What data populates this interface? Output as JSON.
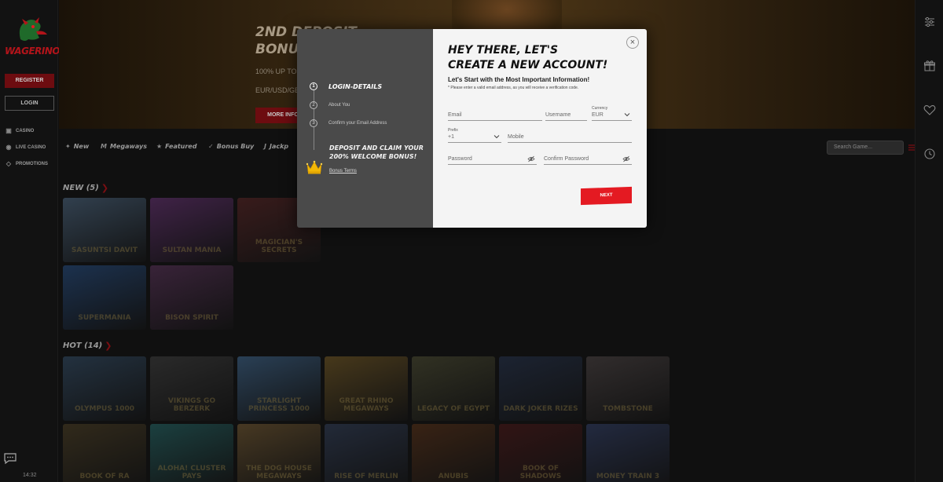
{
  "sidebar": {
    "logo_text": "WAGERINOX",
    "register_label": "Register",
    "login_label": "Login",
    "nav": [
      {
        "label": "Casino",
        "icon": "dice-icon"
      },
      {
        "label": "Live Casino",
        "icon": "live-icon"
      },
      {
        "label": "Promotions",
        "icon": "diamond-icon"
      }
    ],
    "time": "14:32"
  },
  "banner": {
    "title_line1": "2ND DEPOSIT",
    "title_line2": "BONU",
    "subtitle": "100% UP TO",
    "currencies": "EUR/USD/GE",
    "button_label": "MORE INFO"
  },
  "filters": [
    {
      "label": "New",
      "icon": "new-icon"
    },
    {
      "label": "Megaways",
      "icon": "megaways-icon"
    },
    {
      "label": "Featured",
      "icon": "star-icon"
    },
    {
      "label": "Bonus Buy",
      "icon": "check-icon"
    },
    {
      "label": "Jackp",
      "icon": "jackpot-icon"
    }
  ],
  "search": {
    "placeholder": "Search Game..."
  },
  "sections": {
    "new_title": "NEW (5)",
    "hot_title": "HOT (14)"
  },
  "new_games": [
    {
      "title": "Sasuntsi Davit",
      "color": "#5a7a9a"
    },
    {
      "title": "Sultan Mania",
      "color": "#7a3a8a"
    },
    {
      "title": "Magician's Secrets",
      "color": "#6a2a2a"
    },
    {
      "title": "Supermania",
      "color": "#2a5a9a"
    },
    {
      "title": "Bison Spirit",
      "color": "#6a3a6a"
    }
  ],
  "hot_games_row1": [
    {
      "title": "Olympus 1000",
      "color": "#3a5a7a"
    },
    {
      "title": "Vikings Go Berzerk",
      "color": "#4a4a4a"
    },
    {
      "title": "Starlight Princess 1000",
      "color": "#4a7aaa"
    },
    {
      "title": "Great Rhino Megaways",
      "color": "#8a6a2a"
    },
    {
      "title": "Legacy of Egypt",
      "color": "#5a5a3a"
    },
    {
      "title": "Dark Joker Rizes",
      "color": "#2a3a5a"
    },
    {
      "title": "Tombstone",
      "color": "#5a5050"
    }
  ],
  "hot_games_row2": [
    {
      "title": "Book of Ra",
      "color": "#5a4a2a"
    },
    {
      "title": "Aloha! Cluster Pays",
      "color": "#2a7a7a"
    },
    {
      "title": "The Dog House Megaways",
      "color": "#8a6a3a"
    },
    {
      "title": "Rise of Merlin",
      "color": "#3a4a6a"
    },
    {
      "title": "Anubis",
      "color": "#6a3a1a"
    },
    {
      "title": "Book of Shadows",
      "color": "#5a1a1a"
    },
    {
      "title": "Money Train 3",
      "color": "#3a4a7a"
    }
  ],
  "modal": {
    "steps": [
      {
        "num": "1",
        "label": "LOGIN-DETAILS",
        "active": true
      },
      {
        "num": "2",
        "label": "About You",
        "active": false
      },
      {
        "num": "3",
        "label": "Confirm your Email Address",
        "active": false
      }
    ],
    "deposit_title": "DEPOSIT AND CLAIM YOUR 200% WELCOME BONUS!",
    "bonus_terms": "Bonus Terms",
    "title_line1": "HEY THERE, LET'S",
    "title_line2": "CREATE A NEW ACCOUNT!",
    "subtitle": "Let's Start with the Most Important Information!",
    "note": "* Please enter a valid email address, as you will receive a verification code.",
    "fields": {
      "email": "Email",
      "username": "Username",
      "currency_label": "Currency",
      "currency_value": "EUR",
      "prefix_label": "Prefix",
      "prefix_value": "+1",
      "mobile": "Mobile",
      "password": "Password",
      "confirm_password": "Confirm Password"
    },
    "next_label": "NEXT"
  },
  "colors": {
    "accent": "#e41a22",
    "modal_left": "#4a4a4a",
    "modal_right": "#f4f4f4"
  }
}
